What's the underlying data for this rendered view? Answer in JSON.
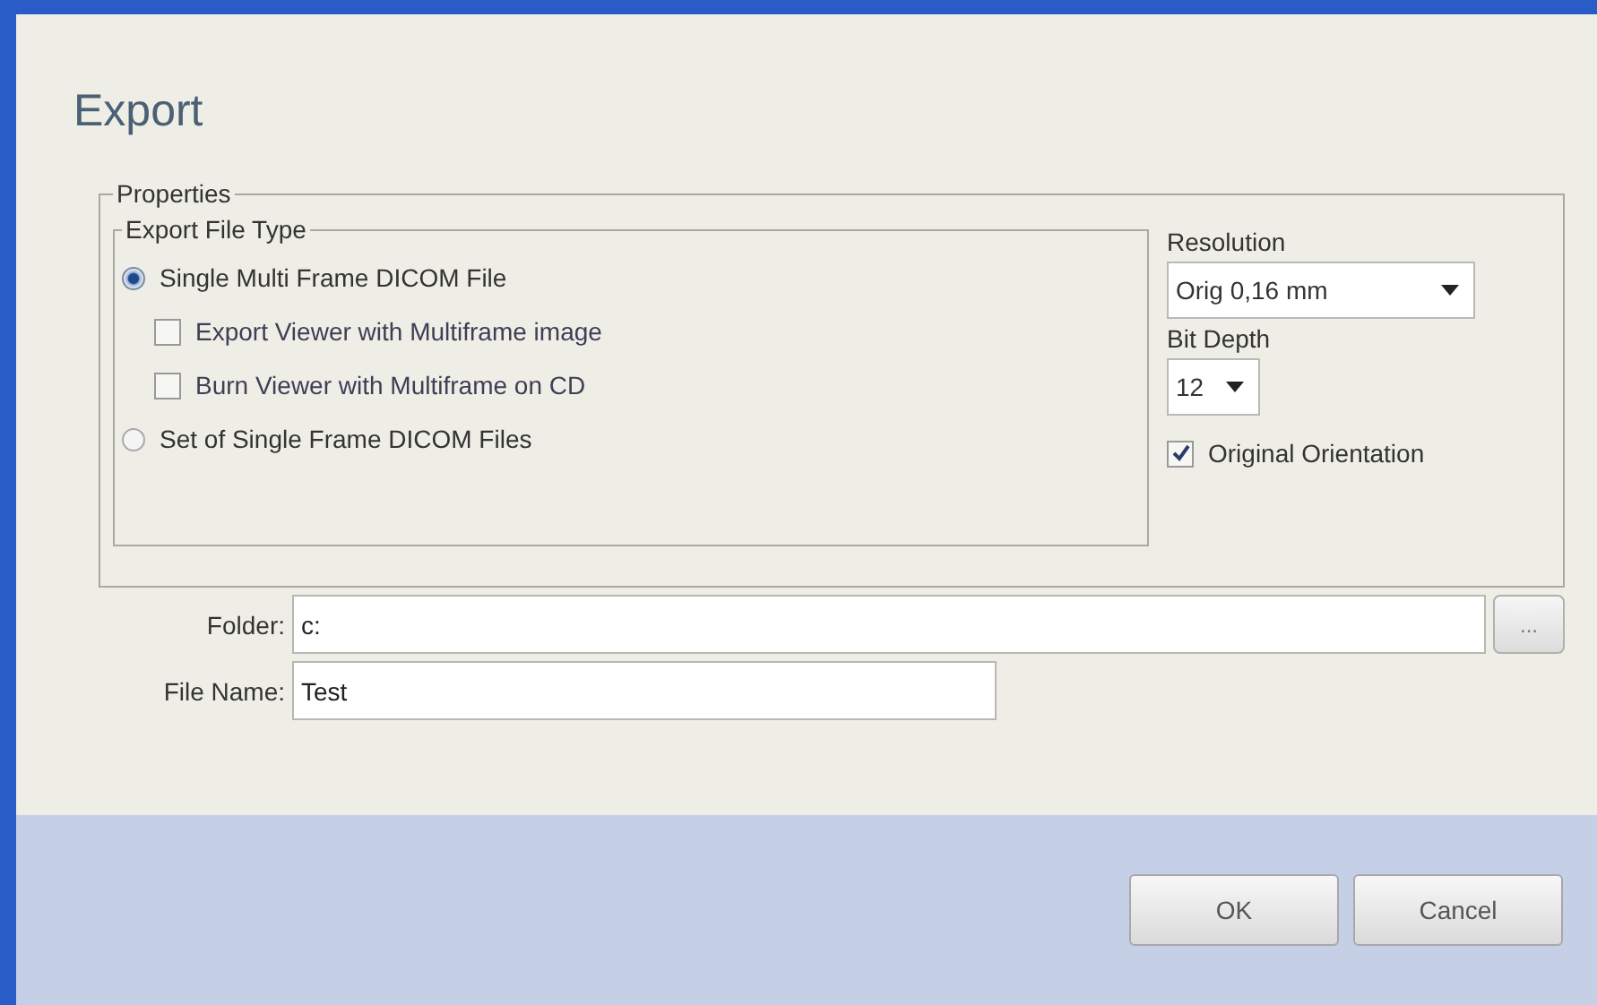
{
  "dialog": {
    "title": "Export"
  },
  "properties": {
    "legend": "Properties",
    "file_type": {
      "legend": "Export File Type",
      "options": [
        {
          "label": "Single Multi Frame DICOM File",
          "selected": true,
          "children": [
            {
              "label": "Export Viewer with Multiframe image",
              "checked": false
            },
            {
              "label": "Burn Viewer with Multiframe on CD",
              "checked": false
            }
          ]
        },
        {
          "label": "Set of Single Frame DICOM Files",
          "selected": false
        }
      ]
    },
    "resolution": {
      "label": "Resolution",
      "value": "Orig 0,16 mm"
    },
    "bit_depth": {
      "label": "Bit Depth",
      "value": "12"
    },
    "orientation": {
      "label": "Original Orientation",
      "checked": true
    }
  },
  "folder": {
    "label": "Folder:",
    "value": "c:",
    "browse": "..."
  },
  "file_name": {
    "label": "File Name:",
    "value": "Test"
  },
  "buttons": [
    "OK",
    "Cancel"
  ]
}
